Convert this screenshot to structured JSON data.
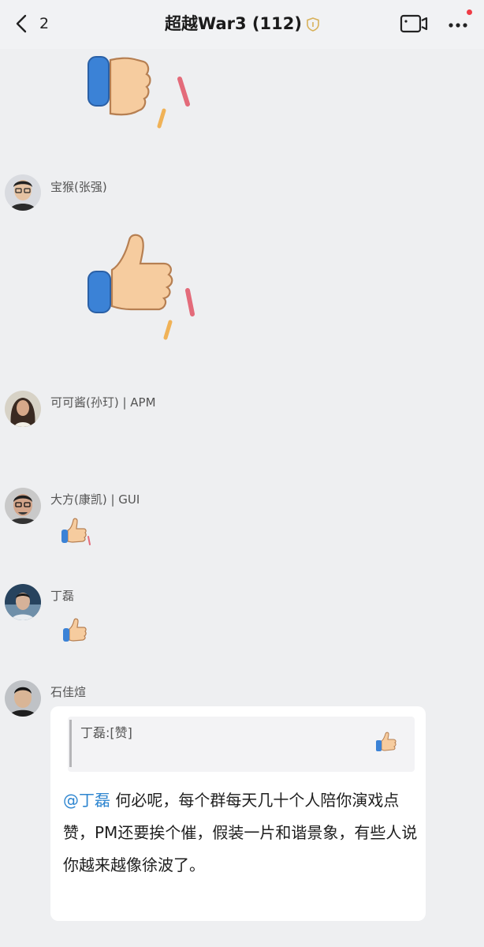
{
  "header": {
    "back_count": "2",
    "title": "超越War3 (112)"
  },
  "messages": [
    {
      "sender": "宝猴(张强)"
    },
    {
      "sender": "可可酱(孙玎) | APM"
    },
    {
      "sender": "大方(康凯) | GUI"
    },
    {
      "sender": "丁磊"
    },
    {
      "sender": "石佳煊",
      "quote": "丁磊:[赞]",
      "mention": "@丁磊",
      "text": " 何必呢，每个群每天几十个人陪你演戏点赞，PM还要挨个催，假装一片和谐景象，有些人说你越来越像徐波了。"
    }
  ],
  "icons": {
    "back": "chevron-left-icon",
    "group_badge": "shield-icon",
    "video": "video-call-icon",
    "more": "more-dots-icon",
    "sticker": "thumbs-up-icon"
  },
  "colors": {
    "background": "#eeeff1",
    "bubble": "#ffffff",
    "mention": "#2f86d0",
    "notify_dot": "#ef3b45"
  }
}
